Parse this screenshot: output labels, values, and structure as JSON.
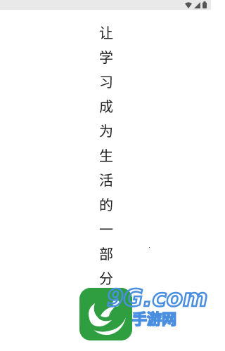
{
  "status_bar": {
    "time": "",
    "icons": [
      "wifi-icon",
      "signal-icon",
      "battery-icon"
    ]
  },
  "slogan": {
    "characters": [
      "让",
      "学",
      "习",
      "成",
      "为",
      "生",
      "活",
      "的",
      "一",
      "部",
      "分"
    ]
  },
  "app_icon": {
    "name": "app-logo-icon",
    "color": "#2f9e41"
  },
  "watermark": {
    "site": "9G.com",
    "caption": "手游网",
    "color": "#4a8ee0"
  }
}
